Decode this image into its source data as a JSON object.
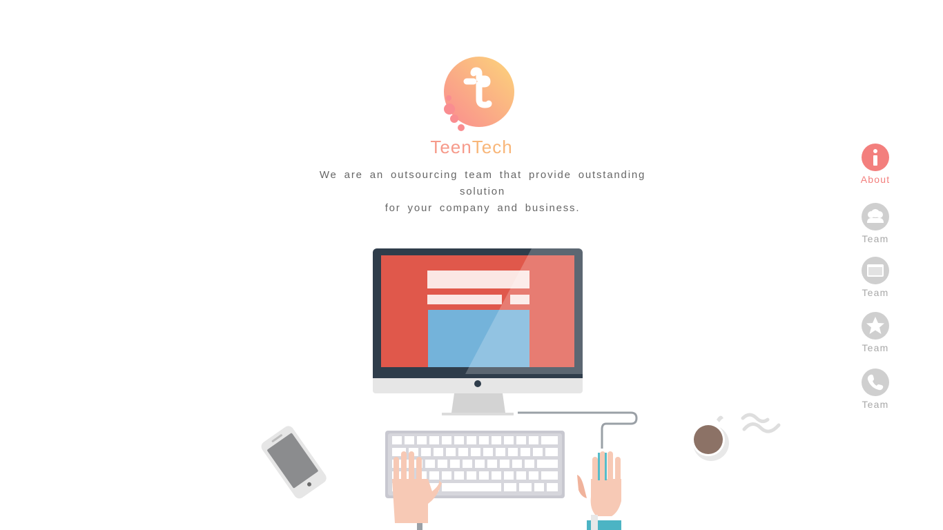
{
  "brand": {
    "logo_letter": "t",
    "name_part1": "Teen",
    "name_part2": "Tech"
  },
  "tagline": {
    "line1": "We are an outsourcing team that provide outstanding solution",
    "line2": "for your company and business."
  },
  "nav": {
    "items": [
      {
        "label": "About",
        "icon": "info-icon",
        "active": true
      },
      {
        "label": "Team",
        "icon": "team-icon",
        "active": false
      },
      {
        "label": "Team",
        "icon": "folder-icon",
        "active": false
      },
      {
        "label": "Team",
        "icon": "star-icon",
        "active": false
      },
      {
        "label": "Team",
        "icon": "phone-icon",
        "active": false
      }
    ]
  },
  "colors": {
    "active": "#f37f7d",
    "inactive": "#c8c8c8",
    "logo_gradient_start": "#f98b8f",
    "logo_gradient_end": "#fcd57a",
    "screen_red": "#e0584b",
    "screen_blue": "#74b3da"
  }
}
